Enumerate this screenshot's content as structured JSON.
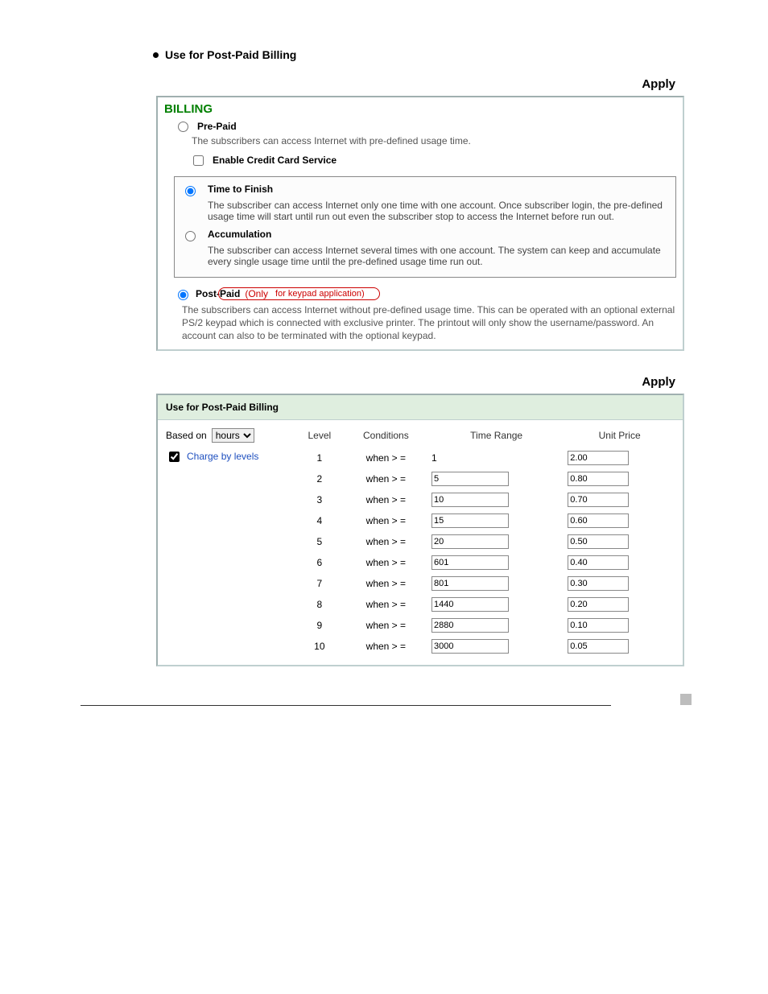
{
  "heading": "Use for Post-Paid Billing",
  "panel1": {
    "applyLabel": "Apply",
    "billingTitle": "BILLING",
    "prepaidLabel": "Pre-Paid",
    "prepaidDesc": "The subscribers can access Internet with pre-defined usage time.",
    "enableCC": "Enable Credit Card Service",
    "timeToFinish": {
      "title": "Time to Finish",
      "desc": "The subscriber can access Internet only one time with one account. Once subscriber login, the pre-defined usage time will start until run out even the subscriber stop to access the Internet before run out."
    },
    "accumulation": {
      "title": "Accumulation",
      "desc": "The subscriber can access Internet several times with one account. The system can keep and accumulate every single usage time until the pre-defined usage time run out."
    },
    "postpaidLabel": "Post-Paid",
    "postpaidRedPrefix": "(Only ",
    "postpaidRedCircled": "for keypad application)",
    "postpaidDesc": "The subscribers can access Internet without pre-defined usage time. This can be operated with an optional external PS/2 keypad which is connected with exclusive printer. The printout will only show the username/password. An account can also to be terminated with the optional keypad."
  },
  "panel2": {
    "applyLabel": "Apply",
    "title": "Use for Post-Paid Billing",
    "basedOnLabel": "Based on",
    "basedOnValue": "hours",
    "chargeLabel": "Charge by levels",
    "headers": {
      "level": "Level",
      "conditions": "Conditions",
      "timeRange": "Time Range",
      "unitPrice": "Unit Price"
    },
    "conditionText": "when > =",
    "rows": [
      {
        "level": "1",
        "timeRange": "1",
        "unitPrice": "2.00",
        "tr_editable": false
      },
      {
        "level": "2",
        "timeRange": "5",
        "unitPrice": "0.80",
        "tr_editable": true
      },
      {
        "level": "3",
        "timeRange": "10",
        "unitPrice": "0.70",
        "tr_editable": true
      },
      {
        "level": "4",
        "timeRange": "15",
        "unitPrice": "0.60",
        "tr_editable": true
      },
      {
        "level": "5",
        "timeRange": "20",
        "unitPrice": "0.50",
        "tr_editable": true
      },
      {
        "level": "6",
        "timeRange": "601",
        "unitPrice": "0.40",
        "tr_editable": true
      },
      {
        "level": "7",
        "timeRange": "801",
        "unitPrice": "0.30",
        "tr_editable": true
      },
      {
        "level": "8",
        "timeRange": "1440",
        "unitPrice": "0.20",
        "tr_editable": true
      },
      {
        "level": "9",
        "timeRange": "2880",
        "unitPrice": "0.10",
        "tr_editable": true
      },
      {
        "level": "10",
        "timeRange": "3000",
        "unitPrice": "0.05",
        "tr_editable": true
      }
    ]
  }
}
